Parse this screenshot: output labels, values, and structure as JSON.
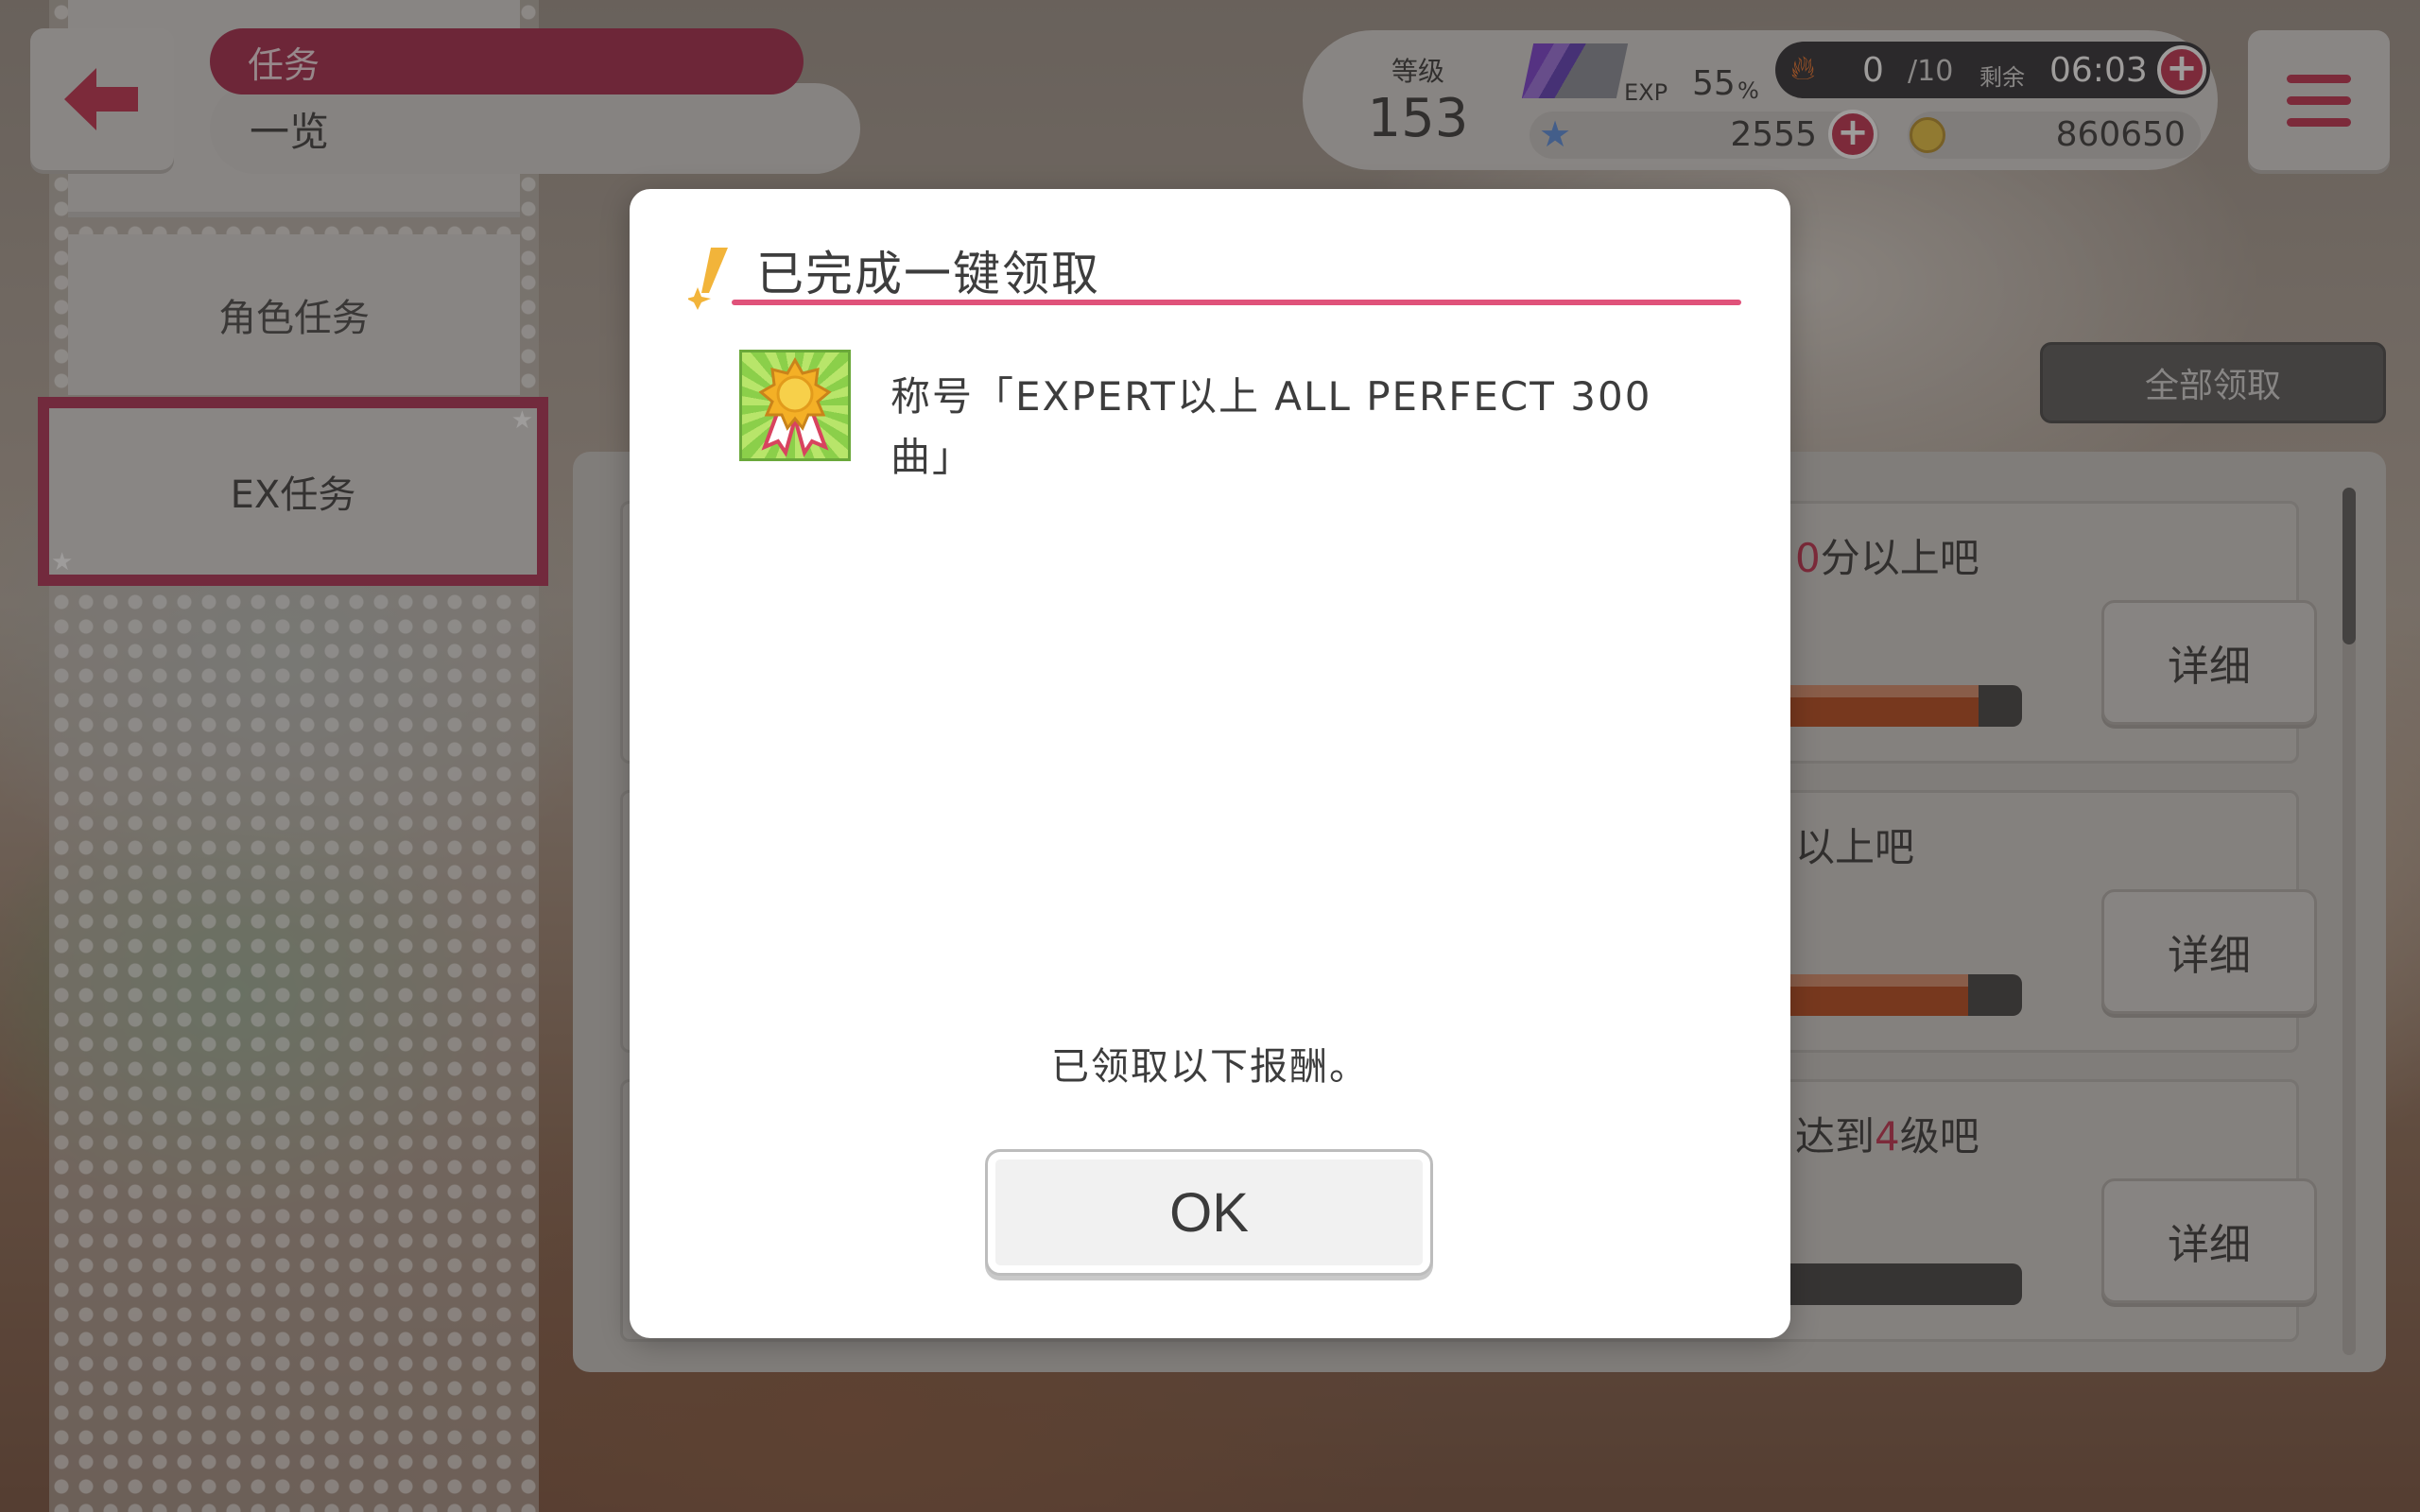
{
  "header": {
    "title": "任务",
    "subtitle": "一览"
  },
  "sidebar": {
    "items": [
      {
        "label": "角色任务"
      },
      {
        "label": "EX任务",
        "active": true
      }
    ]
  },
  "status": {
    "level_label": "等级",
    "level": "153",
    "exp_label": "EXP",
    "exp_percent": "55",
    "exp_percent_symbol": "%",
    "energy_current": "0",
    "energy_max": "/10",
    "energy_remaining_label": "剩余",
    "energy_timer": "06:03",
    "stars": "2555",
    "coins": "860650"
  },
  "toolbar": {
    "receive_all_label": "全部领取"
  },
  "missions": [
    {
      "title_prefix": "0",
      "title_suffix": "分以上吧",
      "detail_label": "详细",
      "progress": 0.88
    },
    {
      "title_prefix": "",
      "title_suffix": "以上吧",
      "detail_label": "详细",
      "progress": 0.85
    },
    {
      "title_pre": "达到",
      "title_prefix": "4",
      "title_suffix": "级吧",
      "detail_label": "详细",
      "progress": 0.26
    }
  ],
  "dialog": {
    "title": "已完成一键领取",
    "reward_text": "称号「EXPERT以上 ALL PERFECT 300曲」",
    "message": "已领取以下报酬。",
    "ok_label": "OK"
  },
  "colors": {
    "accent": "#c2314f",
    "accent_dark": "#a6284b",
    "dialog_rule": "#e0527a",
    "progress_fill": "#b84a1c"
  },
  "icons": {
    "back": "arrow-left-icon",
    "menu": "hamburger-icon",
    "energy": "fire-icon",
    "star": "star-icon",
    "coin": "coin-icon",
    "title_reward": "medal-icon",
    "dialog_header": "sparkle-pen-icon"
  }
}
